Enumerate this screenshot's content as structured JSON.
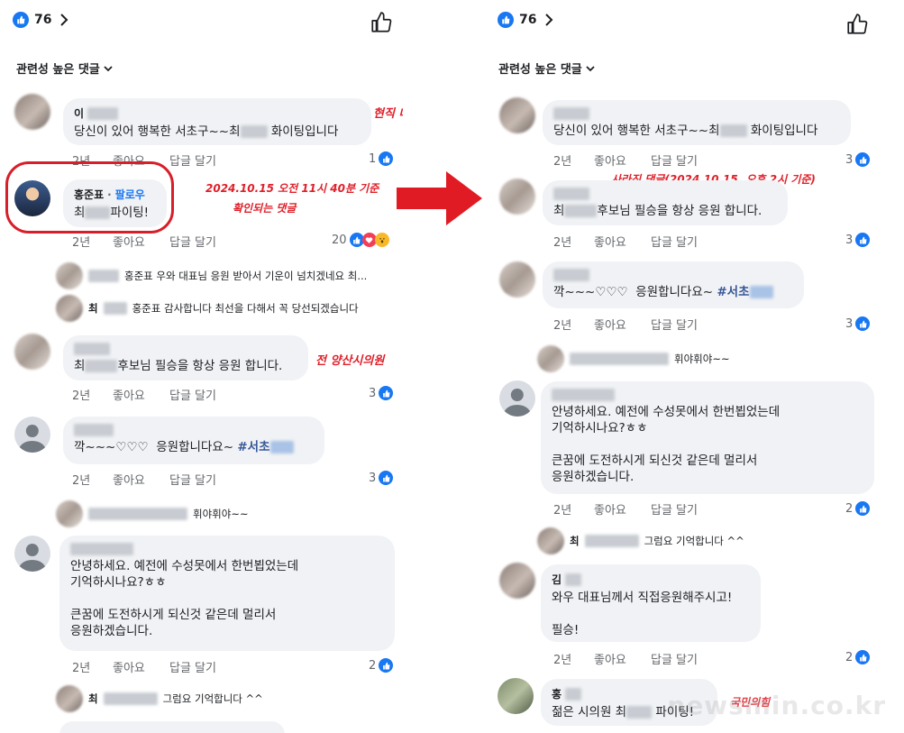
{
  "left": {
    "reaction_count": "76",
    "sort_label": "관련성 높은 댓글",
    "comments": [
      {
        "author": "이",
        "text": "당신이 있어 행복한 서초구~~최",
        "text_suffix": "화이팅입니다",
        "age": "2년",
        "like": "좋아요",
        "reply": "답글 달기",
        "count": "1"
      },
      {
        "author": "홍준표",
        "follow": "팔로우",
        "text": "최",
        "text_suffix": "파이팅!",
        "age": "2년",
        "like": "좋아요",
        "reply": "답글 달기",
        "count": "20"
      },
      {
        "author": "",
        "text": "최",
        "text_suffix": "후보님 필승을 항상 응원 합니다.",
        "age": "2년",
        "like": "좋아요",
        "reply": "답글 달기",
        "count": "3"
      },
      {
        "author": "",
        "text": "깍~~~♡♡♡  응원합니다요~ ",
        "tag": "#서초",
        "age": "2년",
        "like": "좋아요",
        "reply": "답글 달기",
        "count": "3"
      },
      {
        "author": "",
        "text": "안녕하세요. 예전에 수성못에서 한번뵙었는데\n기억하시나요?ㅎㅎ\n\n큰꿈에 도전하시게 되신것 같은데 멀리서\n응원하겠습니다.",
        "age": "2년",
        "like": "좋아요",
        "reply": "답글 달기",
        "count": "2"
      }
    ],
    "replies": [
      {
        "text": "홍준표 우와 대표님 응원 받아서 기운이 넘치겠네요 최..."
      },
      {
        "name": "최",
        "text": "홍준표 감사합니다 최선을 다해서 꼭 당선되겠습니다"
      },
      {
        "text": "휘야휘야~~"
      },
      {
        "name": "최",
        "text": "그럼요 기억합니다 ^^"
      }
    ],
    "annotations": {
      "official": "현직 대구시 공무원",
      "timestamp_line1": "2024.10.15 오전 11시 40분 기준",
      "timestamp_line2": "확인되는 댓글",
      "former": "전 양산시의원"
    }
  },
  "right": {
    "reaction_count": "76",
    "sort_label": "관련성 높은 댓글",
    "comments": [
      {
        "author": "",
        "text": "당신이 있어 행복한 서초구~~최",
        "text_suffix": "화이팅입니다",
        "age": "2년",
        "like": "좋아요",
        "reply": "답글 달기",
        "count": "3"
      },
      {
        "author": "",
        "text": "최",
        "text_suffix": "후보님 필승을 항상 응원 합니다.",
        "age": "2년",
        "like": "좋아요",
        "reply": "답글 달기",
        "count": "3"
      },
      {
        "author": "",
        "text": "깍~~~♡♡♡  응원합니다요~ ",
        "tag": "#서초",
        "age": "2년",
        "like": "좋아요",
        "reply": "답글 달기",
        "count": "3"
      },
      {
        "author": "",
        "text": "안녕하세요. 예전에 수성못에서 한번뵙었는데\n기억하시나요?ㅎㅎ\n\n큰꿈에 도전하시게 되신것 같은데 멀리서\n응원하겠습니다.",
        "age": "2년",
        "like": "좋아요",
        "reply": "답글 달기",
        "count": "2"
      },
      {
        "author": "김",
        "text": "와우 대표님께서 직접응원해주시고!\n\n필승!",
        "age": "2년",
        "like": "좋아요",
        "reply": "답글 달기",
        "count": "2"
      },
      {
        "author": "홍",
        "text": "젊은 시의원 최",
        "text_suffix": "파이팅!",
        "age": "",
        "like": "",
        "reply": "",
        "count": ""
      }
    ],
    "replies": [
      {
        "text": "휘야휘야~~"
      },
      {
        "name": "최",
        "text": "그럼요 기억합니다 ^^"
      }
    ],
    "annotations": {
      "deleted": "사라진 댓글(2024.10.15, 오후 2시 기준)",
      "bottom": "국민의힘"
    }
  },
  "watermark": "newsmin.co.kr",
  "colors": {
    "facebook_blue": "#1877f2",
    "annotation_red": "#e0202a",
    "bubble_gray": "#f0f2f5"
  },
  "icons": [
    "like-badge-icon",
    "chevron-right-icon",
    "thumbs-up-icon",
    "chevron-down-icon",
    "big-arrow-icon"
  ]
}
